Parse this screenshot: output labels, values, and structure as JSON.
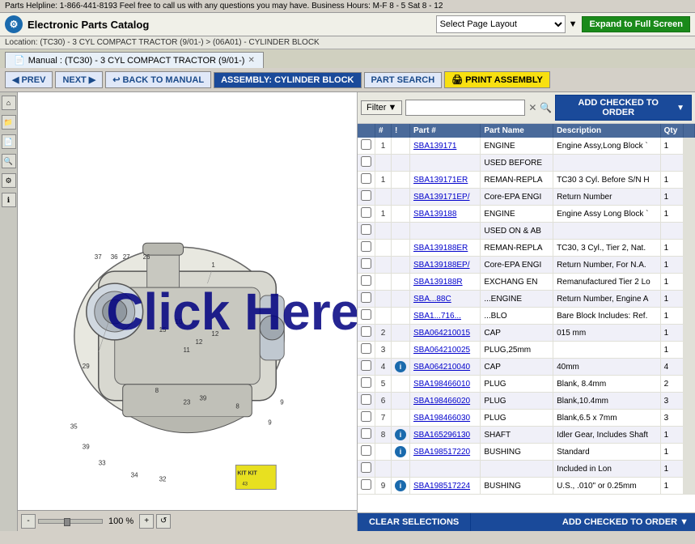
{
  "banner": {
    "text": "Parts Helpline: 1-866-441-8193 Feel free to call us with any questions you may have. Business Hours: M-F 8 - 5 Sat 8 - 12"
  },
  "header": {
    "app_title": "Electronic Parts Catalog",
    "page_layout_label": "Select Page Layout",
    "expand_btn": "Expand to Full Screen"
  },
  "location": {
    "text": "Location: (TC30) - 3 CYL COMPACT TRACTOR (9/01-) > (06A01) - CYLINDER BLOCK"
  },
  "tab": {
    "label": "Manual : (TC30) - 3 CYL COMPACT TRACTOR (9/01-)"
  },
  "toolbar": {
    "prev": "PREV",
    "next": "NEXT",
    "back_to_manual": "BACK TO MANUAL",
    "assembly": "ASSEMBLY: CYLINDER BLOCK",
    "part_search": "PART SEARCH",
    "print": "PRINT ASSEMBLY"
  },
  "filter": {
    "label": "Filter",
    "placeholder": "",
    "add_to_order": "ADD CHECKED TO ORDER"
  },
  "table": {
    "columns": [
      "",
      "#",
      "!",
      "Part #",
      "Part Name",
      "Description",
      "Qty"
    ],
    "rows": [
      {
        "num": "1",
        "info": false,
        "part": "SBA139171",
        "name": "ENGINE",
        "desc": "Engine Assy,Long Block `",
        "qty": "1"
      },
      {
        "num": "",
        "info": false,
        "part": "",
        "name": "USED BEFORE",
        "desc": "",
        "qty": ""
      },
      {
        "num": "1",
        "info": false,
        "part": "SBA139171ER",
        "name": "REMAN-REPLA",
        "desc": "TC30 3 Cyl. Before S/N H",
        "qty": "1"
      },
      {
        "num": "",
        "info": false,
        "part": "SBA139171EP/",
        "name": "Core-EPA ENGI",
        "desc": "Return Number",
        "qty": "1"
      },
      {
        "num": "1",
        "info": false,
        "part": "SBA139188",
        "name": "ENGINE",
        "desc": "Engine Assy Long Block `",
        "qty": "1"
      },
      {
        "num": "",
        "info": false,
        "part": "",
        "name": "USED ON & AB",
        "desc": "",
        "qty": ""
      },
      {
        "num": "",
        "info": false,
        "part": "SBA139188ER",
        "name": "REMAN-REPLA",
        "desc": "TC30, 3 Cyl., Tier 2, Nat.",
        "qty": "1"
      },
      {
        "num": "",
        "info": false,
        "part": "SBA139188EP/",
        "name": "Core-EPA ENGI",
        "desc": "Return Number, For N.A.",
        "qty": "1"
      },
      {
        "num": "",
        "info": false,
        "part": "SBA139188R",
        "name": "EXCHANG EN",
        "desc": "Remanufactured Tier 2 Lo",
        "qty": "1"
      },
      {
        "num": "",
        "info": false,
        "part": "SBA...88C",
        "name": "...ENGINE",
        "desc": "Return Number, Engine A",
        "qty": "1"
      },
      {
        "num": "",
        "info": false,
        "part": "SBA1...716...",
        "name": "...BLO",
        "desc": "Bare Block Includes: Ref.",
        "qty": "1"
      },
      {
        "num": "2",
        "info": false,
        "part": "SBA064210015",
        "name": "CAP",
        "desc": "015 mm",
        "qty": "1"
      },
      {
        "num": "3",
        "info": false,
        "part": "SBA064210025",
        "name": "PLUG,25mm",
        "desc": "",
        "qty": "1"
      },
      {
        "num": "4",
        "info": true,
        "part": "SBA064210040",
        "name": "CAP",
        "desc": "40mm",
        "qty": "4"
      },
      {
        "num": "5",
        "info": false,
        "part": "SBA198466010",
        "name": "PLUG",
        "desc": "Blank, 8.4mm",
        "qty": "2"
      },
      {
        "num": "6",
        "info": false,
        "part": "SBA198466020",
        "name": "PLUG",
        "desc": "Blank,10.4mm",
        "qty": "3"
      },
      {
        "num": "7",
        "info": false,
        "part": "SBA198466030",
        "name": "PLUG",
        "desc": "Blank,6.5 x 7mm",
        "qty": "3"
      },
      {
        "num": "8",
        "info": true,
        "part": "SBA165296130",
        "name": "SHAFT",
        "desc": "Idler Gear, Includes Shaft",
        "qty": "1"
      },
      {
        "num": "",
        "info": true,
        "part": "SBA198517220",
        "name": "BUSHING",
        "desc": "Standard",
        "qty": "1"
      },
      {
        "num": "",
        "info": false,
        "part": "",
        "name": "",
        "desc": "Included in Lon",
        "qty": "1"
      },
      {
        "num": "9",
        "info": true,
        "part": "SBA198517224",
        "name": "BUSHING",
        "desc": "U.S., .010\" or 0.25mm",
        "qty": "1"
      }
    ]
  },
  "zoom": {
    "pct": "100 %"
  },
  "bottom": {
    "clear": "CLEAR SELECTIONS",
    "add_order": "ADD CHECKED TO ORDER"
  },
  "overlay": {
    "click_here": "Click Here!"
  }
}
